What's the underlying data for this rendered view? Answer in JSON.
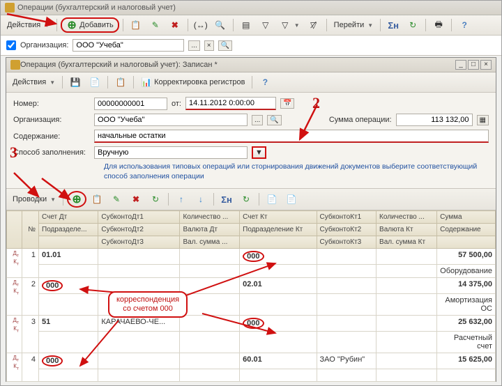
{
  "outer": {
    "title": "Операции (бухгалтерский и налоговый учет)",
    "actions_label": "Действия",
    "add_label": "Добавить",
    "go_label": "Перейти",
    "filter": {
      "org_label": "Организация:",
      "org_value": "ООО \"Учеба\""
    }
  },
  "inner": {
    "title": "Операция (бухгалтерский и налоговый учет): Записан *",
    "actions_label": "Действия",
    "korrect_label": "Корректировка регистров",
    "num_label": "Номер:",
    "num_value": "00000000001",
    "ot_label": "от:",
    "date_value": "14.11.2012 0:00:00",
    "org_label": "Организация:",
    "org_value": "ООО \"Учеба\"",
    "sum_label": "Сумма операции:",
    "sum_value": "113 132,00",
    "content_label": "Содержание:",
    "content_value": "начальные остатки",
    "fill_label": "Способ заполнения:",
    "fill_value": "Вручную",
    "hint": "Для использования типовых операций или сторнирования движений документов выберите соответствующий способ заполнения операции",
    "entries_label": "Проводки"
  },
  "grid": {
    "headers": {
      "num": "№",
      "acct_dt": "Счет Дт",
      "subk_dt1": "СубконтоДт1",
      "qty": "Количество ...",
      "acct_kt": "Счет Кт",
      "subk_kt1": "СубконтоКт1",
      "qty2": "Количество ...",
      "sum": "Сумма",
      "subdiv_dt": "Подразделе...",
      "subk_dt2": "СубконтоДт2",
      "val_dt": "Валюта Дт",
      "subdiv_kt": "Подразделение Кт",
      "subk_kt2": "СубконтоКт2",
      "val_kt": "Валюта Кт",
      "content": "Содержание",
      "subk_dt3": "СубконтоДт3",
      "valsum_dt": "Вал. сумма ...",
      "subk_kt3": "СубконтоКт3",
      "valsum_kt": "Вал. сумма Кт"
    },
    "rows": [
      {
        "idx": "1",
        "dt": "01.01",
        "sub_dt": "",
        "kt": "000",
        "sub_kt": "",
        "sum": "57 500,00",
        "desc": "Оборудование"
      },
      {
        "idx": "2",
        "dt": "000",
        "sub_dt": "",
        "kt": "02.01",
        "sub_kt": "",
        "sum": "14 375,00",
        "desc": "Амортизация ОС"
      },
      {
        "idx": "3",
        "dt": "51",
        "sub_dt": "КАРАЧАЕВО-ЧЕ...",
        "kt": "000",
        "sub_kt": "",
        "sum": "25 632,00",
        "desc": "Расчетный счет"
      },
      {
        "idx": "4",
        "dt": "000",
        "sub_dt": "",
        "kt": "60.01",
        "sub_kt": "ЗАО \"Рубин\"",
        "sum": "15 625,00",
        "desc": ""
      }
    ]
  },
  "callout": {
    "line1": "корреспонденция",
    "line2": "со счетом 000"
  },
  "annot": {
    "n2": "2",
    "n3": "3"
  }
}
